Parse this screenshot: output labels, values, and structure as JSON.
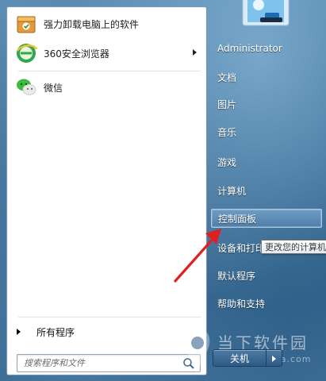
{
  "programs": [
    {
      "label": "强力卸载电脑上的软件",
      "icon": "uninstall-box-icon"
    },
    {
      "label": "360安全浏览器",
      "icon": "360-browser-icon",
      "has_submenu": true
    },
    {
      "label": "微信",
      "icon": "wechat-icon"
    }
  ],
  "all_programs": {
    "label": "所有程序"
  },
  "search": {
    "placeholder": "搜索程序和文件"
  },
  "right_column": {
    "items": [
      {
        "label": "Administrator"
      },
      {
        "label": "文档"
      },
      {
        "label": "图片"
      },
      {
        "label": "音乐"
      },
      {
        "label": "游戏"
      },
      {
        "label": "计算机"
      },
      {
        "label": "控制面板"
      },
      {
        "label": "设备和打印机"
      },
      {
        "label": "默认程序"
      },
      {
        "label": "帮助和支持"
      }
    ],
    "highlighted": "控制面板"
  },
  "tooltip": {
    "text": "更改您的计算机"
  },
  "shutdown": {
    "label": "关机"
  },
  "watermark": {
    "text": "当下软件园",
    "sub": "www.downxia.com"
  },
  "colors": {
    "highlight": "#5d8cb8",
    "annotation": "#e02020"
  }
}
